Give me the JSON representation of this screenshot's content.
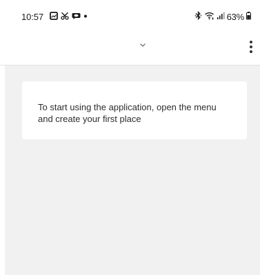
{
  "status_bar": {
    "time": "10:57",
    "battery_percent": "63%",
    "left_icons": [
      "gallery-icon",
      "scissors-icon",
      "chat-bubble-icon",
      "notification-dot-icon"
    ],
    "right_icons": [
      "bluetooth-icon",
      "wifi-icon",
      "signal-icon",
      "battery-icon"
    ]
  },
  "app_bar": {
    "title_dropdown_icon": "chevron-down-icon",
    "overflow_menu_icon": "more-vert-icon"
  },
  "main": {
    "empty_state_message": "To start using the application, open the menu and create your first place"
  },
  "colors": {
    "background": "#f1f1f1",
    "surface": "#ffffff",
    "text_primary": "#2d2d2d",
    "icon": "#333333"
  }
}
